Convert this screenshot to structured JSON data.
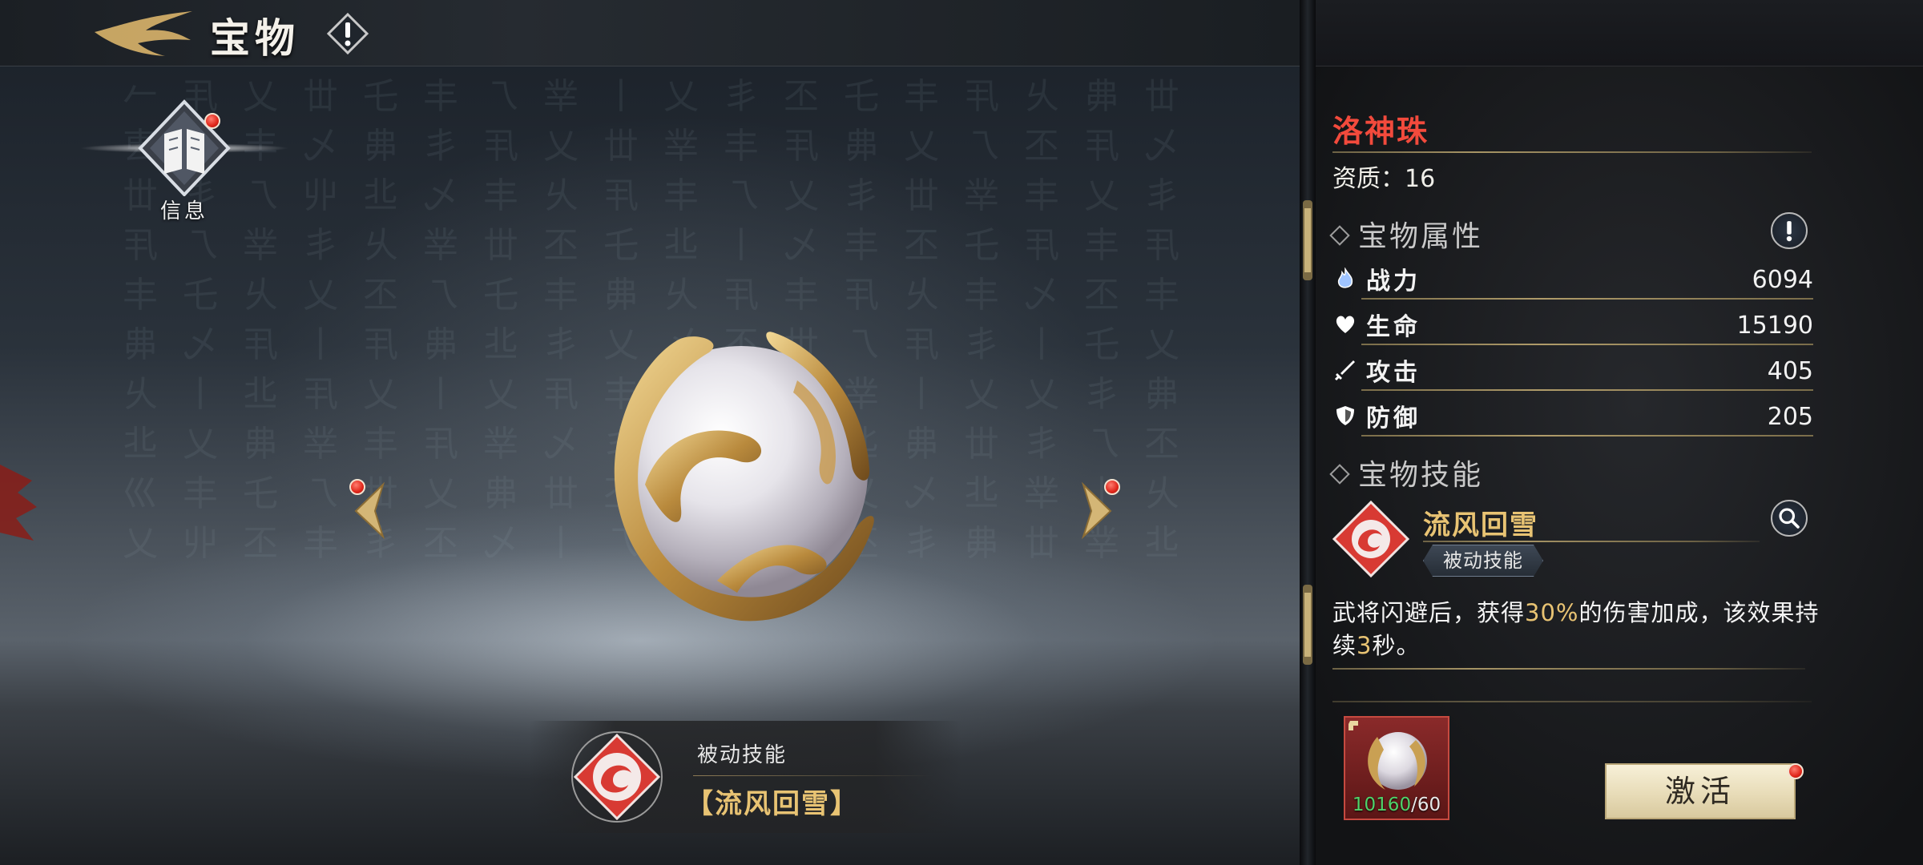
{
  "header": {
    "title": "宝物",
    "back_icon": "golden-wing-back-icon",
    "info_icon": "exclamation-icon"
  },
  "left": {
    "info_label": "信息",
    "skill_strip": {
      "type_label": "被动技能",
      "name": "【流风回雪】"
    }
  },
  "item": {
    "name": "洛神珠",
    "quality_label": "资质：",
    "quality_value": "16",
    "attr_section": "宝物属性",
    "stats": [
      {
        "label": "战力",
        "value": "6094",
        "icon": "flame-icon"
      },
      {
        "label": "生命",
        "value": "15190",
        "icon": "heart-icon"
      },
      {
        "label": "攻击",
        "value": "405",
        "icon": "sword-icon"
      },
      {
        "label": "防御",
        "value": "205",
        "icon": "shield-icon"
      }
    ],
    "skill_section": "宝物技能",
    "skill": {
      "name": "流风回雪",
      "type": "被动技能",
      "desc_1": "武将闪避后，获得",
      "desc_pct": "30%",
      "desc_2": "的伤害加成，该效果持续",
      "desc_sec": "3",
      "desc_3": "秒。"
    },
    "pieces": {
      "have": "10160",
      "need": "/60"
    },
    "activate_label": "激活"
  },
  "colors": {
    "item_name": "#f24a3c",
    "gold_text": "#e8c373",
    "panel_bg": "#141518",
    "badge_red": "#e0261a"
  }
}
